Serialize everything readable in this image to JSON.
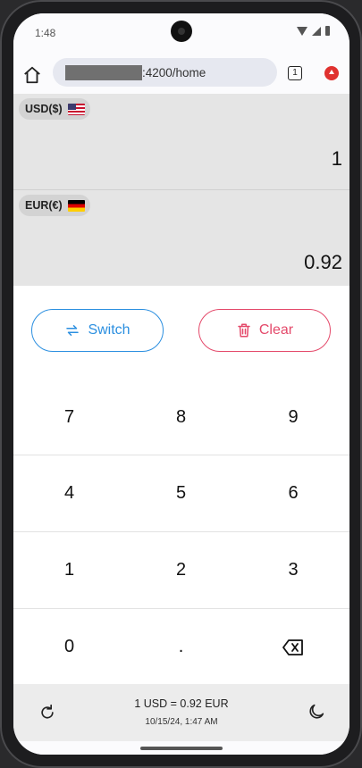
{
  "status_bar": {
    "time": "1:48"
  },
  "browser": {
    "url_suffix": ":4200/home",
    "tab_count": "1"
  },
  "from_currency": {
    "label": "USD($)",
    "value": "1"
  },
  "to_currency": {
    "label": "EUR(€)",
    "value": "0.92"
  },
  "actions": {
    "switch_label": "Switch",
    "clear_label": "Clear"
  },
  "keypad": {
    "keys": [
      "7",
      "8",
      "9",
      "4",
      "5",
      "6",
      "1",
      "2",
      "3",
      "0",
      "."
    ]
  },
  "footer": {
    "rate": "1 USD = 0.92 EUR",
    "updated": "10/15/24, 1:47 AM"
  },
  "colors": {
    "accent_blue": "#2b8fe0",
    "accent_red": "#e4496a",
    "panel_grey": "#e5e5e5"
  },
  "icons": {
    "home": "home-icon",
    "tabs": "tabs-icon",
    "extension": "extension-icon",
    "switch": "swap-icon",
    "clear": "trash-icon",
    "backspace": "backspace-icon",
    "refresh": "refresh-icon",
    "theme": "moon-icon"
  }
}
